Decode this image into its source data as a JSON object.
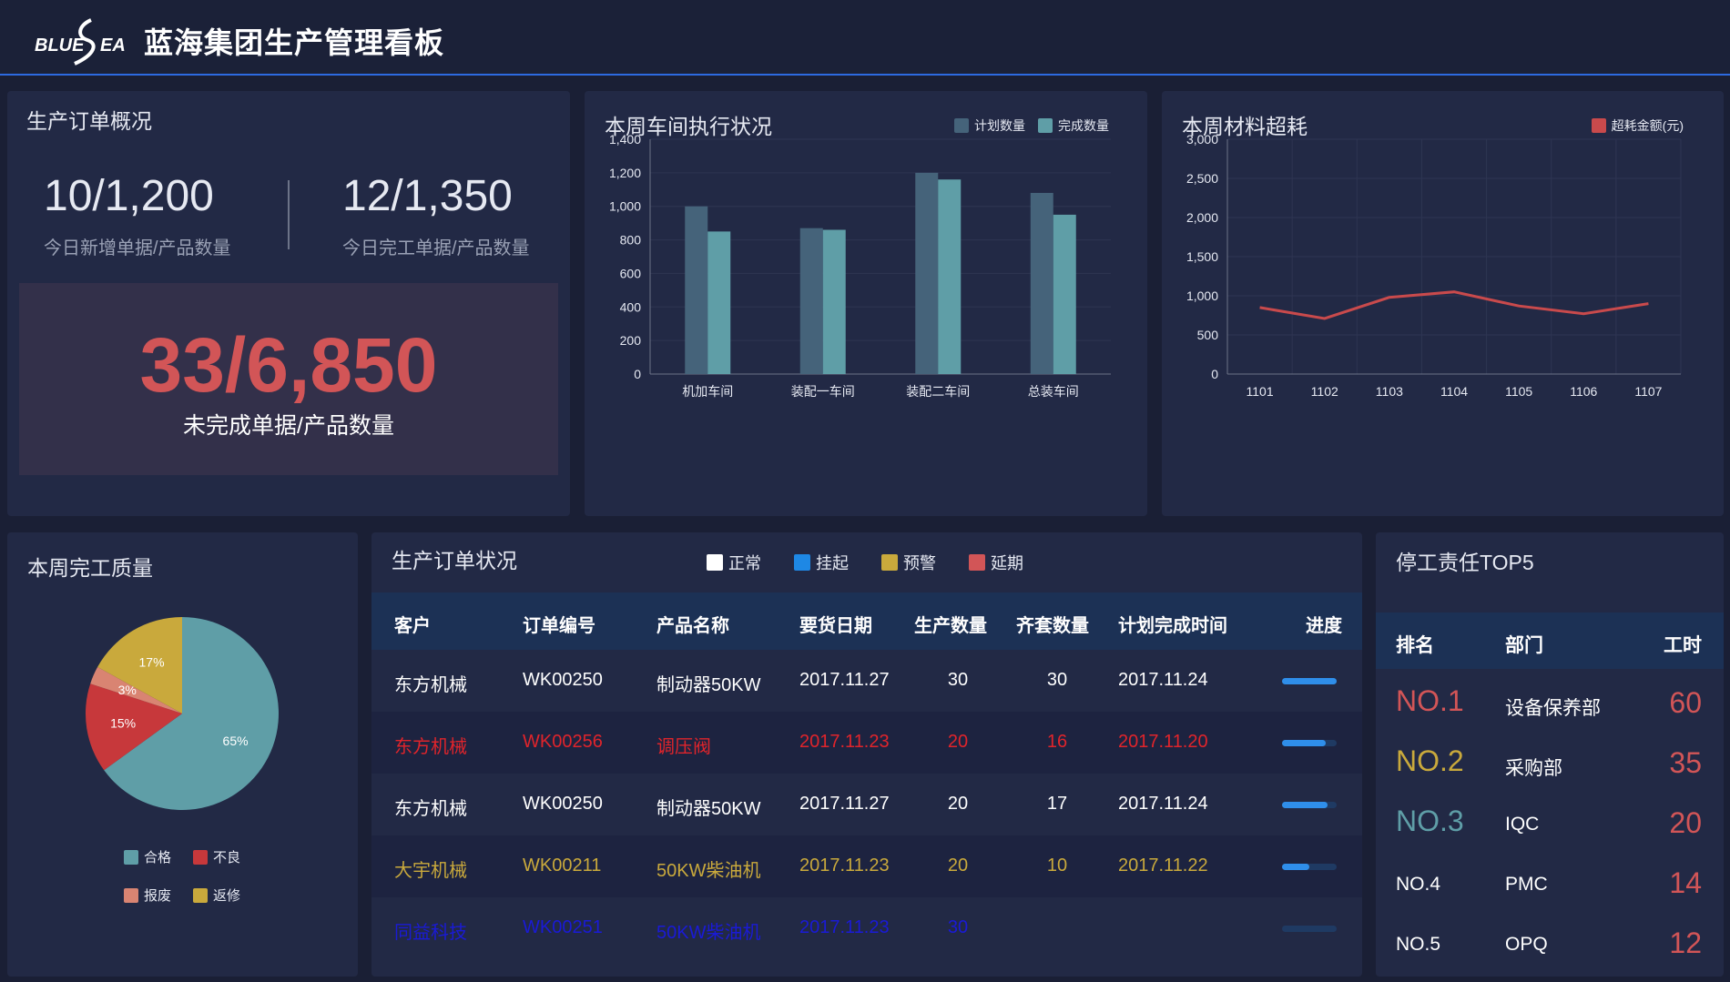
{
  "header": {
    "logo_text": "BLUESEA",
    "title": "蓝海集团生产管理看板"
  },
  "overview": {
    "title": "生产订单概况",
    "new_today": {
      "value": "10/1,200",
      "label": "今日新增单据/产品数量"
    },
    "done_today": {
      "value": "12/1,350",
      "label": "今日完工单据/产品数量"
    },
    "pending": {
      "value": "33/6,850",
      "label": "未完成单据/产品数量"
    }
  },
  "workshop": {
    "title": "本周车间执行状况",
    "chart_data": {
      "type": "bar",
      "categories": [
        "机加车间",
        "装配一车间",
        "装配二车间",
        "总装车间"
      ],
      "series": [
        {
          "name": "计划数量",
          "values": [
            1000,
            870,
            1200,
            1080
          ],
          "color": "#45637a"
        },
        {
          "name": "完成数量",
          "values": [
            850,
            860,
            1160,
            950
          ],
          "color": "#5f9ea7"
        }
      ],
      "ylim": [
        0,
        1400
      ],
      "yticks": [
        "0",
        "200",
        "400",
        "600",
        "800",
        "1,000",
        "1,200",
        "1,400"
      ],
      "legend_position": "top-right"
    }
  },
  "material": {
    "title": "本周材料超耗",
    "chart_data": {
      "type": "line",
      "x": [
        "1101",
        "1102",
        "1103",
        "1104",
        "1105",
        "1106",
        "1107"
      ],
      "series": [
        {
          "name": "超耗金额(元)",
          "values": [
            850,
            710,
            980,
            1050,
            870,
            770,
            900
          ],
          "color": "#c94a4c"
        }
      ],
      "ylim": [
        0,
        3000
      ],
      "yticks": [
        "0",
        "500",
        "1,000",
        "1,500",
        "2,000",
        "2,500",
        "3,000"
      ],
      "grid": true,
      "legend_position": "top-right"
    }
  },
  "quality": {
    "title": "本周完工质量",
    "chart_data": {
      "type": "pie",
      "slices": [
        {
          "name": "合格",
          "value": 65,
          "label": "65%",
          "color": "#5f9ea7"
        },
        {
          "name": "不良",
          "value": 15,
          "label": "15%",
          "color": "#c7383b"
        },
        {
          "name": "报废",
          "value": 3,
          "label": "3%",
          "color": "#d98472"
        },
        {
          "name": "返修",
          "value": 17,
          "label": "17%",
          "color": "#c9a93c"
        }
      ],
      "legend_position": "bottom"
    }
  },
  "orders": {
    "title": "生产订单状况",
    "status_legend": [
      {
        "label": "正常",
        "color": "#ffffff"
      },
      {
        "label": "挂起",
        "color": "#1e88e5"
      },
      {
        "label": "预警",
        "color": "#c9a93c"
      },
      {
        "label": "延期",
        "color": "#d25557"
      }
    ],
    "columns": [
      "客户",
      "订单编号",
      "产品名称",
      "要货日期",
      "生产数量",
      "齐套数量",
      "计划完成时间",
      "进度"
    ],
    "rows": [
      {
        "customer": "东方机械",
        "order_no": "WK00250",
        "product": "制动器50KW",
        "due": "2017.11.27",
        "qty": "30",
        "kit": "30",
        "plan": "2017.11.24",
        "progress": 1.0,
        "color": "#ffffff"
      },
      {
        "customer": "东方机械",
        "order_no": "WK00256",
        "product": "调压阀",
        "due": "2017.11.23",
        "qty": "20",
        "kit": "16",
        "plan": "2017.11.20",
        "progress": 0.8,
        "color": "#e0242b"
      },
      {
        "customer": "东方机械",
        "order_no": "WK00250",
        "product": "制动器50KW",
        "due": "2017.11.27",
        "qty": "20",
        "kit": "17",
        "plan": "2017.11.24",
        "progress": 0.83,
        "color": "#ffffff"
      },
      {
        "customer": "大宇机械",
        "order_no": "WK00211",
        "product": "50KW柴油机",
        "due": "2017.11.23",
        "qty": "20",
        "kit": "10",
        "plan": "2017.11.22",
        "progress": 0.5,
        "color": "#c9a93c"
      },
      {
        "customer": "同益科技",
        "order_no": "WK00251",
        "product": "50KW柴油机",
        "due": "2017.11.23",
        "qty": "30",
        "kit": "",
        "plan": "",
        "progress": 0.0,
        "color": "#1a1ad6"
      }
    ]
  },
  "top5": {
    "title": "停工责任TOP5",
    "columns": [
      "排名",
      "部门",
      "工时"
    ],
    "rows": [
      {
        "rank": "NO.1",
        "dept": "设备保养部",
        "hours": "60",
        "rank_color": "#d25557"
      },
      {
        "rank": "NO.2",
        "dept": "采购部",
        "hours": "35",
        "rank_color": "#c9a93c"
      },
      {
        "rank": "NO.3",
        "dept": "IQC",
        "hours": "20",
        "rank_color": "#5f9ea7"
      },
      {
        "rank": "NO.4",
        "dept": "PMC",
        "hours": "14",
        "rank_color": "#ffffff"
      },
      {
        "rank": "NO.5",
        "dept": "OPQ",
        "hours": "12",
        "rank_color": "#ffffff"
      }
    ]
  }
}
